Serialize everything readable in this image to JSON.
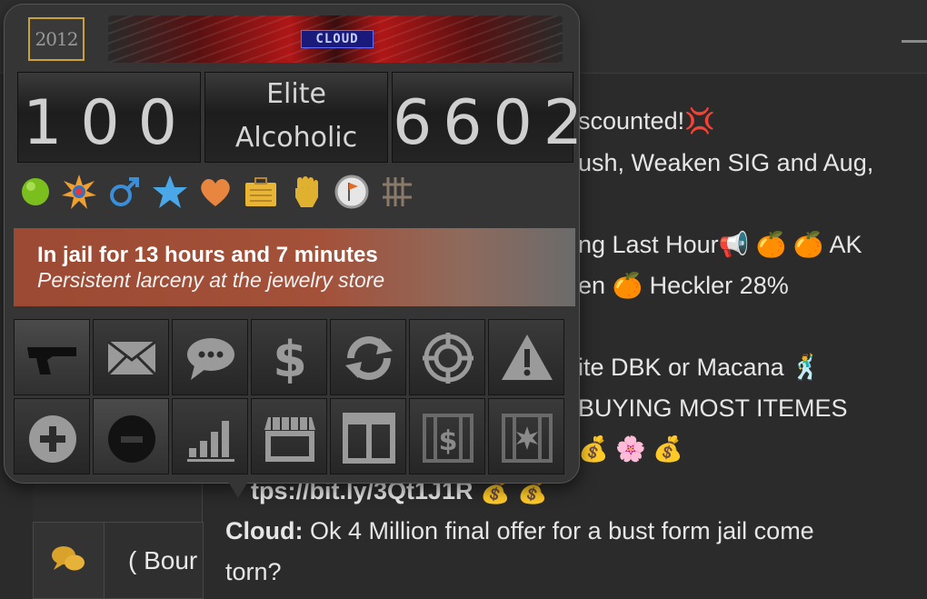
{
  "background_chat": {
    "lines": [
      {
        "text": "scounted!💢"
      },
      {
        "text": "ush, Weaken SIG and Aug,"
      },
      {
        "text": "ng Last Hour📢 🍊 🍊 AK"
      },
      {
        "text": "en 🍊 Heckler 28%"
      },
      {
        "text": "ite DBK or Macana 🕺"
      },
      {
        "text": "BUYING MOST ITEMES"
      },
      {
        "text": "💰 🌸 💰"
      },
      {
        "text": "tps://bit.ly/3Qt1J1R 💰 💰"
      },
      {
        "author": "Cloud:",
        "text": " Ok 4 Million final offer for a bust form jail come"
      },
      {
        "text": "torn?"
      }
    ],
    "tab_label": "( Bour"
  },
  "profile": {
    "avatar_text": "2012",
    "banner_label": "CLOUD",
    "level": "100",
    "rank_line1": "Elite",
    "rank_line2": "Alcoholic",
    "player_id": "6602",
    "status_icons": [
      {
        "icon": "online-dot-icon",
        "glyph": "●",
        "color": "#7bbf1e"
      },
      {
        "icon": "badge-burst-icon",
        "glyph": "✹",
        "color": "#e08a2a"
      },
      {
        "icon": "male-icon",
        "glyph": "♂",
        "color": "#3a8fd8"
      },
      {
        "icon": "star-icon",
        "glyph": "★",
        "color": "#4aa7e8"
      },
      {
        "icon": "heart-icon",
        "glyph": "♥",
        "color": "#e8853e"
      },
      {
        "icon": "briefcase-icon",
        "glyph": "▤",
        "color": "#e8b535"
      },
      {
        "icon": "fist-icon",
        "glyph": "✊",
        "color": "#e0b030"
      },
      {
        "icon": "clock-flag-icon",
        "glyph": "◔",
        "color": "#dcdcdc"
      },
      {
        "icon": "jail-bars-icon",
        "glyph": "#",
        "color": "#8a7a6a"
      }
    ],
    "jail_title": "In jail for 13 hours and 7 minutes",
    "jail_reason": "Persistent larceny at the jewelry store"
  },
  "actions": [
    {
      "name": "attack",
      "icon": "gun-icon"
    },
    {
      "name": "message",
      "icon": "envelope-icon"
    },
    {
      "name": "chat",
      "icon": "speech-bubble-icon"
    },
    {
      "name": "send-money",
      "icon": "dollar-icon"
    },
    {
      "name": "trade",
      "icon": "refresh-arrows-icon"
    },
    {
      "name": "bounty",
      "icon": "crosshair-icon"
    },
    {
      "name": "report",
      "icon": "warning-icon"
    },
    {
      "name": "add-friend",
      "icon": "plus-circle-icon"
    },
    {
      "name": "add-enemy",
      "icon": "minus-circle-icon"
    },
    {
      "name": "stats",
      "icon": "bar-chart-icon"
    },
    {
      "name": "bazaar",
      "icon": "shop-icon"
    },
    {
      "name": "display-case",
      "icon": "display-case-icon"
    },
    {
      "name": "bail",
      "icon": "jail-dollar-icon"
    },
    {
      "name": "bust",
      "icon": "jail-bust-icon"
    }
  ]
}
